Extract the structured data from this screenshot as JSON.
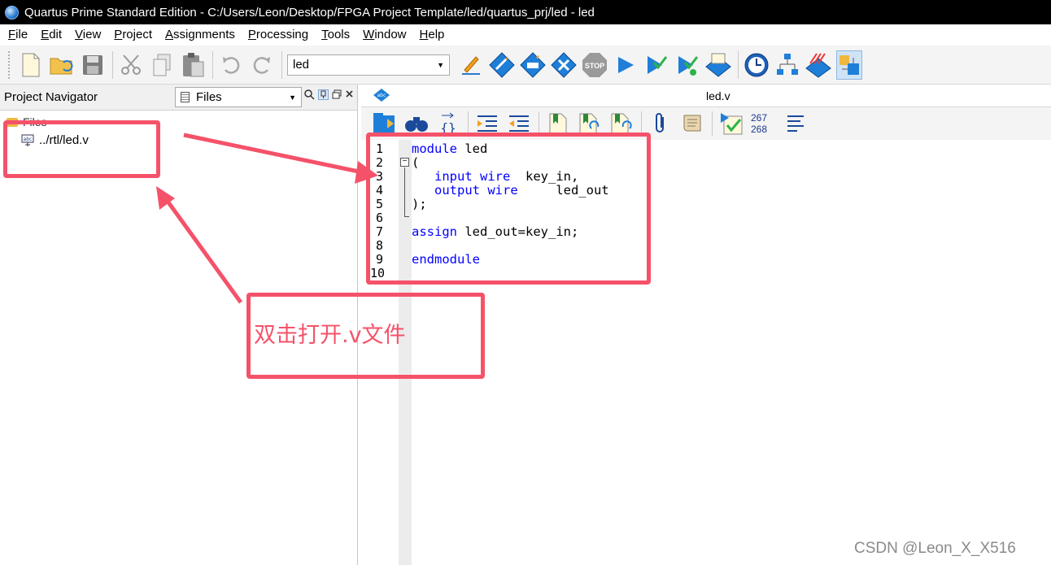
{
  "window": {
    "title": "Quartus Prime Standard Edition - C:/Users/Leon/Desktop/FPGA Project Template/led/quartus_prj/led - led"
  },
  "menu": [
    "File",
    "Edit",
    "View",
    "Project",
    "Assignments",
    "Processing",
    "Tools",
    "Window",
    "Help"
  ],
  "toolbar": {
    "entity_combo": "led",
    "icons": [
      "new-file-icon",
      "open-icon",
      "save-icon",
      "cut-icon",
      "copy-icon",
      "paste-icon",
      "undo-icon",
      "redo-icon",
      "settings-pencil-icon",
      "analysis-icon",
      "synthesis-icon",
      "fitter-icon",
      "stop-icon",
      "start-compilation-icon",
      "assembler-icon",
      "timing-analyzer-icon",
      "netlist-viewer-icon",
      "timequest-icon",
      "rtl-viewer-icon",
      "eda-netlist-icon",
      "chip-planner-icon"
    ]
  },
  "navigator": {
    "title": "Project Navigator",
    "view_combo": "Files",
    "tree_root": "Files",
    "file_item": "../rtl/led.v"
  },
  "editor": {
    "tab_title": "led.v",
    "line_counts": [
      "267",
      "268"
    ],
    "line_numbers": [
      "1",
      "2",
      "3",
      "4",
      "5",
      "6",
      "7",
      "8",
      "9",
      "10"
    ],
    "code": [
      [
        {
          "t": "module",
          "kw": true
        },
        {
          "t": " led",
          "kw": false
        }
      ],
      [
        {
          "t": "(",
          "kw": false
        }
      ],
      [
        {
          "t": "   ",
          "kw": false
        },
        {
          "t": "input wire",
          "kw": true
        },
        {
          "t": "  key_in,",
          "kw": false
        }
      ],
      [
        {
          "t": "   ",
          "kw": false
        },
        {
          "t": "output wire",
          "kw": true
        },
        {
          "t": "     led_out",
          "kw": false
        }
      ],
      [
        {
          "t": ");",
          "kw": false
        }
      ],
      [],
      [
        {
          "t": "assign",
          "kw": true
        },
        {
          "t": " led_out=key_in;",
          "kw": false
        }
      ],
      [],
      [
        {
          "t": "endmodule",
          "kw": true
        }
      ],
      []
    ]
  },
  "annotation": {
    "text": "双击打开.v文件",
    "color": "#f5526a"
  },
  "watermark": "CSDN @Leon_X_X516"
}
